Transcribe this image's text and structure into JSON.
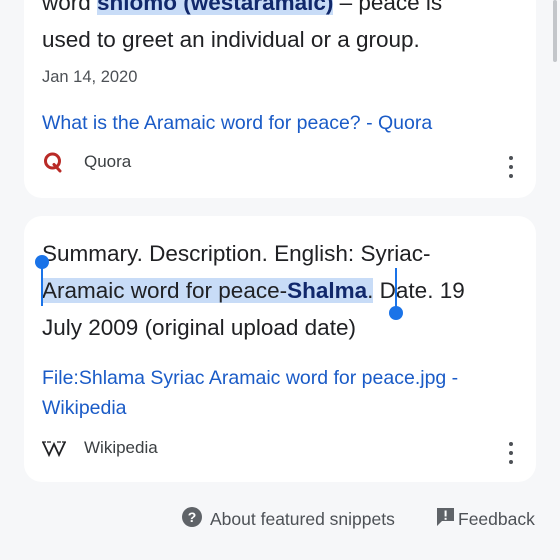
{
  "result1": {
    "snippet_line0_pre": "word ",
    "snippet_line0_hl": "shlomo (westaramaic)",
    "snippet_line0_post": " – peace is",
    "snippet_line1": "used to greet an individual or a group.",
    "date": "Jan 14, 2020",
    "title": "What is the Aramaic word for peace? - Quora",
    "source": "Quora",
    "source_icon": "quora-logo-icon"
  },
  "result2": {
    "snippet_line1": "Summary. Description. English: Syriac-",
    "snippet_sel": "Aramaic word for peace-",
    "snippet_bold": "Shalma",
    "snippet_sel_end": ".",
    "snippet_line2_post": " Date. 19",
    "snippet_line3": "July 2009 (original upload date)",
    "title_line1": "File:Shlama Syriac Aramaic word for peace.jpg -",
    "title_line2": "Wikipedia",
    "source": "Wikipedia",
    "source_icon": "wikipedia-logo-icon"
  },
  "footer": {
    "about": "About featured snippets",
    "feedback": "Feedback"
  },
  "colors": {
    "link": "#1a5bc7",
    "selection": "#c8dcf7",
    "handle": "#1a73e8",
    "quora": "#b92b27"
  }
}
